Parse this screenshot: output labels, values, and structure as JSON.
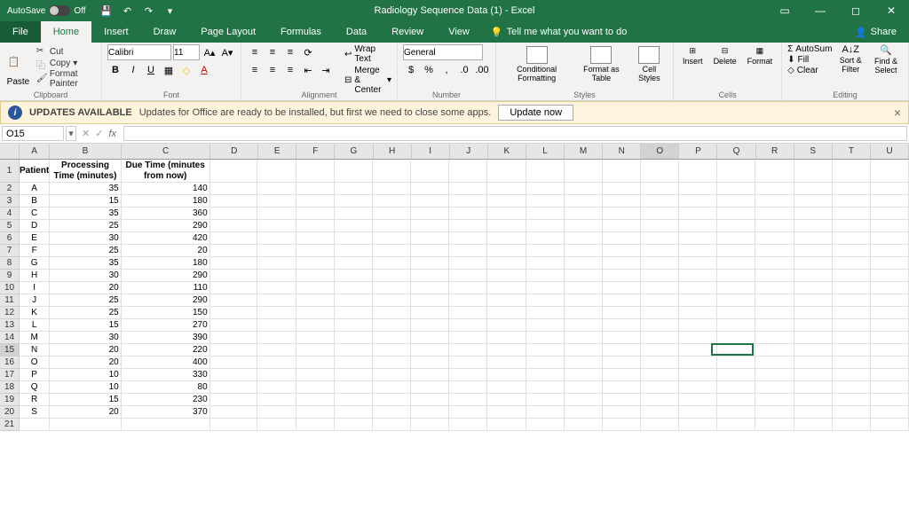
{
  "titlebar": {
    "autosave": "AutoSave",
    "autosave_state": "Off",
    "title": "Radiology Sequence Data (1) - Excel"
  },
  "tabs": {
    "file": "File",
    "home": "Home",
    "insert": "Insert",
    "draw": "Draw",
    "page_layout": "Page Layout",
    "formulas": "Formulas",
    "data": "Data",
    "review": "Review",
    "view": "View",
    "tellme": "Tell me what you want to do",
    "share": "Share"
  },
  "ribbon": {
    "clipboard": {
      "label": "Clipboard",
      "paste": "Paste",
      "cut": "Cut",
      "copy": "Copy",
      "painter": "Format Painter"
    },
    "font": {
      "label": "Font",
      "name": "Calibri",
      "size": "11"
    },
    "alignment": {
      "label": "Alignment",
      "wrap": "Wrap Text",
      "merge": "Merge & Center"
    },
    "number": {
      "label": "Number",
      "format": "General"
    },
    "styles": {
      "label": "Styles",
      "cond": "Conditional Formatting",
      "table": "Format as Table",
      "cell": "Cell Styles"
    },
    "cells": {
      "label": "Cells",
      "insert": "Insert",
      "delete": "Delete",
      "format": "Format"
    },
    "editing": {
      "label": "Editing",
      "autosum": "AutoSum",
      "fill": "Fill",
      "clear": "Clear",
      "sort": "Sort & Filter",
      "find": "Find & Select"
    }
  },
  "update": {
    "title": "UPDATES AVAILABLE",
    "msg": "Updates for Office are ready to be installed, but first we need to close some apps.",
    "btn": "Update now"
  },
  "formula": {
    "cell_ref": "O15",
    "fx": "fx"
  },
  "columns": [
    "A",
    "B",
    "C",
    "D",
    "E",
    "F",
    "G",
    "H",
    "I",
    "J",
    "K",
    "L",
    "M",
    "N",
    "O",
    "P",
    "Q",
    "R",
    "S",
    "T",
    "U"
  ],
  "headers": {
    "A": "Patient",
    "B": "Processing Time (minutes)",
    "C": "Due Time (minutes from now)"
  },
  "rows": [
    {
      "n": 1
    },
    {
      "n": 2,
      "A": "A",
      "B": "35",
      "C": "140"
    },
    {
      "n": 3,
      "A": "B",
      "B": "15",
      "C": "180"
    },
    {
      "n": 4,
      "A": "C",
      "B": "35",
      "C": "360"
    },
    {
      "n": 5,
      "A": "D",
      "B": "25",
      "C": "290"
    },
    {
      "n": 6,
      "A": "E",
      "B": "30",
      "C": "420"
    },
    {
      "n": 7,
      "A": "F",
      "B": "25",
      "C": "20"
    },
    {
      "n": 8,
      "A": "G",
      "B": "35",
      "C": "180"
    },
    {
      "n": 9,
      "A": "H",
      "B": "30",
      "C": "290"
    },
    {
      "n": 10,
      "A": "I",
      "B": "20",
      "C": "110"
    },
    {
      "n": 11,
      "A": "J",
      "B": "25",
      "C": "290"
    },
    {
      "n": 12,
      "A": "K",
      "B": "25",
      "C": "150"
    },
    {
      "n": 13,
      "A": "L",
      "B": "15",
      "C": "270"
    },
    {
      "n": 14,
      "A": "M",
      "B": "30",
      "C": "390"
    },
    {
      "n": 15,
      "A": "N",
      "B": "20",
      "C": "220"
    },
    {
      "n": 16,
      "A": "O",
      "B": "20",
      "C": "400"
    },
    {
      "n": 17,
      "A": "P",
      "B": "10",
      "C": "330"
    },
    {
      "n": 18,
      "A": "Q",
      "B": "10",
      "C": "80"
    },
    {
      "n": 19,
      "A": "R",
      "B": "15",
      "C": "230"
    },
    {
      "n": 20,
      "A": "S",
      "B": "20",
      "C": "370"
    },
    {
      "n": 21
    }
  ],
  "active": {
    "row": 15,
    "col": "O"
  }
}
